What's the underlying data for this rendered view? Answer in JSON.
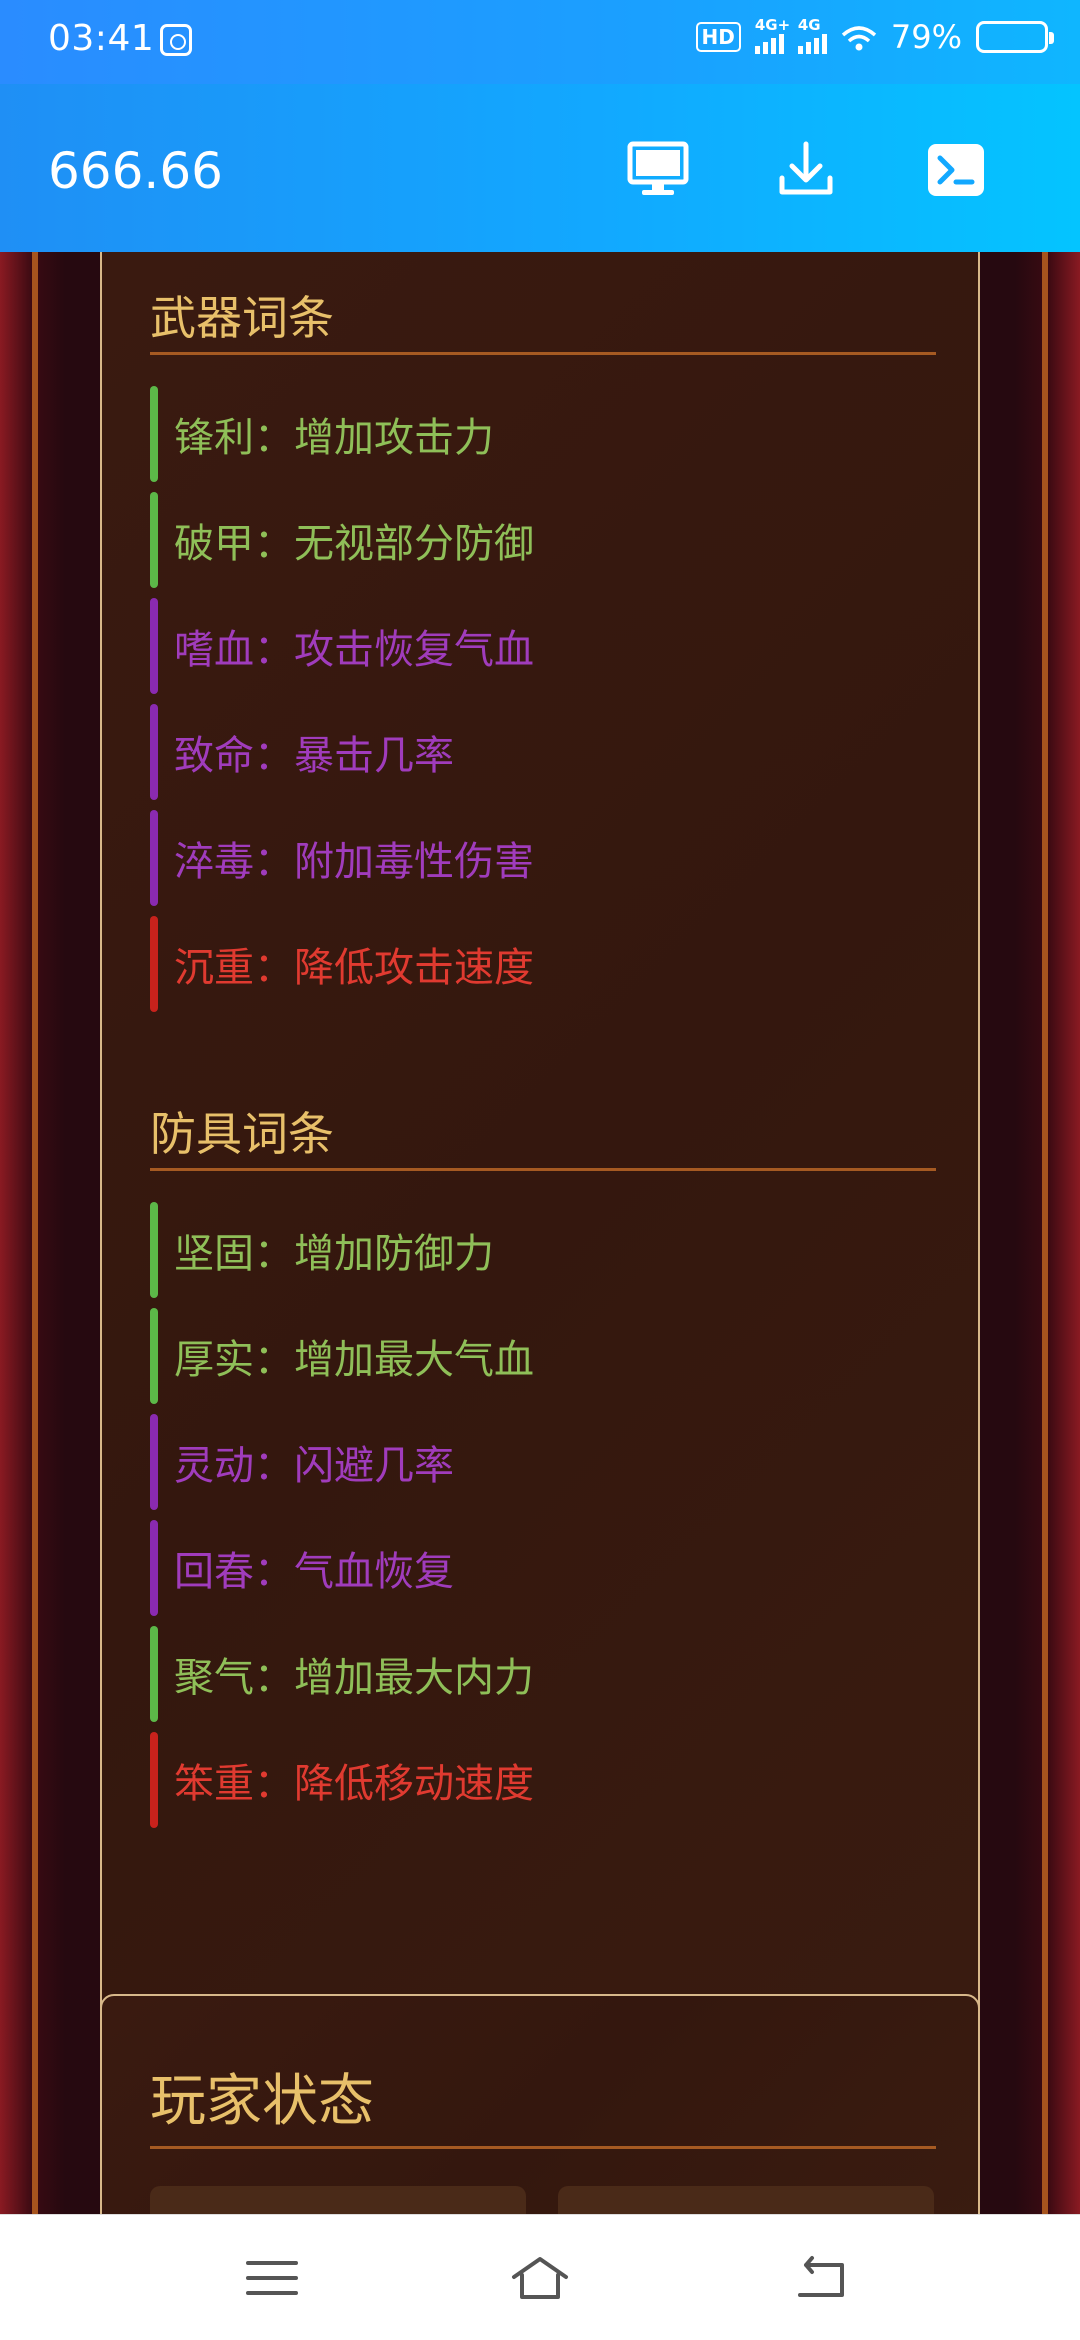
{
  "status_bar": {
    "time": "03:41",
    "hd_label": "HD",
    "network1_label": "4G+",
    "network2_label": "4G",
    "battery_percent": "79%",
    "battery_level": 0.79
  },
  "app_bar": {
    "title": "666.66",
    "icons": [
      "desktop-icon",
      "download-icon",
      "terminal-icon"
    ]
  },
  "weapon_section": {
    "title": "武器词条",
    "entries": [
      {
        "text": "锋利：增加攻击力",
        "color": "green"
      },
      {
        "text": "破甲：无视部分防御",
        "color": "green"
      },
      {
        "text": "嗜血：攻击恢复气血",
        "color": "purple"
      },
      {
        "text": "致命：暴击几率",
        "color": "purple"
      },
      {
        "text": "淬毒：附加毒性伤害",
        "color": "purple"
      },
      {
        "text": "沉重：降低攻击速度",
        "color": "red"
      }
    ]
  },
  "armor_section": {
    "title": "防具词条",
    "entries": [
      {
        "text": "坚固：增加防御力",
        "color": "green"
      },
      {
        "text": "厚实：增加最大气血",
        "color": "green"
      },
      {
        "text": "灵动：闪避几率",
        "color": "purple"
      },
      {
        "text": "回春：气血恢复",
        "color": "purple"
      },
      {
        "text": "聚气：增加最大内力",
        "color": "green"
      },
      {
        "text": "笨重：降低移动速度",
        "color": "red"
      }
    ]
  },
  "player_section": {
    "title": "玩家状态"
  },
  "colors": {
    "title_gold": "#e8c06a",
    "green": "#8fbf58",
    "purple": "#a03cbc",
    "red": "#e03a30",
    "app_bar_blue": "#12a8ff"
  },
  "nav_bar": {
    "icons": [
      "menu-icon",
      "home-icon",
      "back-icon"
    ]
  }
}
